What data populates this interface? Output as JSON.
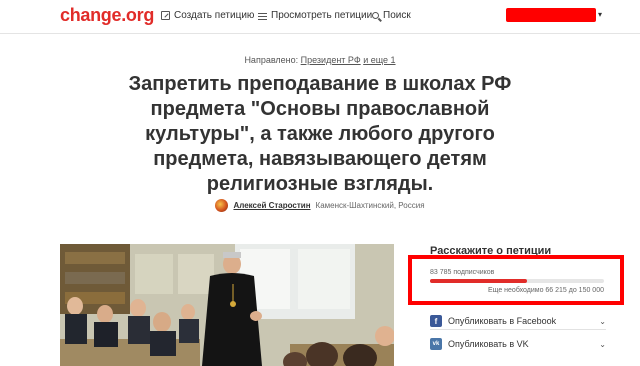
{
  "header": {
    "logo": "change.org",
    "nav": {
      "create": "Создать петицию",
      "browse": "Просмотреть петиции",
      "search": "Поиск"
    },
    "user_chevron": "▾"
  },
  "petition": {
    "directed_prefix": "Направлено: ",
    "directed_target": "Президент РФ",
    "directed_more": "и еще 1",
    "title": "Запретить преподавание в школах РФ предмета \"Основы православной культуры\", а также любого другого предмета, навязывающего детям религиозные взгляды.",
    "author": "Алексей Старостин",
    "location": "Каменск-Шахтинский, Россия"
  },
  "sidebar": {
    "share_title": "Расскажите о петиции",
    "signers": "83 785 подписчиков",
    "needed": "Еще необходимо 66 215 до 150 000",
    "progress_fraction": 0.5586,
    "share_items": [
      {
        "icon": "facebook-icon",
        "label": "Опубликовать в Facebook"
      },
      {
        "icon": "vk-icon",
        "label": "Опубликовать в VK"
      }
    ]
  },
  "colors": {
    "brand": "#e12c29",
    "highlight": "#ff0000",
    "facebook": "#3b5998",
    "vk": "#4a76a8"
  }
}
